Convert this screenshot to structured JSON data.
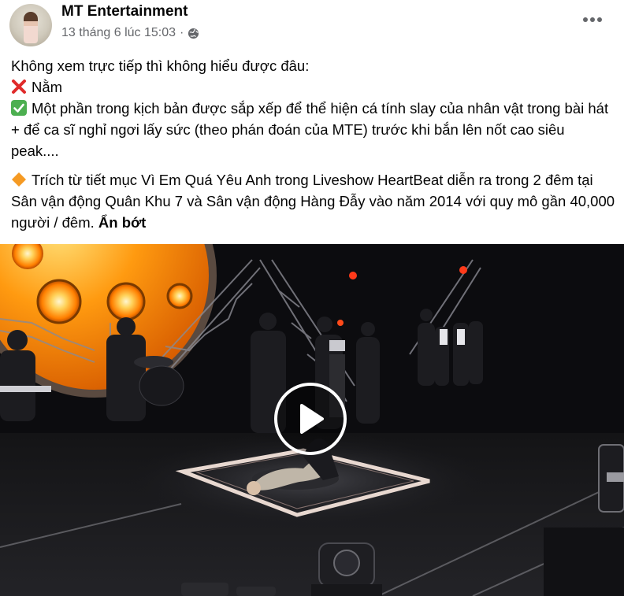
{
  "post": {
    "author": "MT Entertainment",
    "timestamp": "13 tháng 6 lúc 15:03",
    "separator": "·",
    "audience_icon": "globe-icon",
    "more_icon": "more-dots-icon"
  },
  "content": {
    "intro": "Không xem trực tiếp thì không hiểu được đâu:",
    "line_no": "Nằm",
    "line_no_icon": "cross-mark-icon",
    "line_yes": "Một phần trong kịch bản được sắp xếp để thể hiện cá tính slay của nhân vật trong bài hát + để ca sĩ nghỉ ngơi lấy sức (theo phán đoán của MTE) trước khi bắn lên nốt cao siêu peak....",
    "line_yes_icon": "check-mark-icon",
    "detail": "Trích từ tiết mục Vì Em Quá Yêu Anh trong Liveshow HeartBeat diễn ra trong 2 đêm tại Sân vận động Quân Khu 7 và Sân vận động Hàng Đẫy vào năm 2014 với quy mô gần 40,000 người / đêm.",
    "detail_icon": "orange-diamond-icon",
    "see_less": "Ẩn bớt"
  },
  "video": {
    "play_icon": "play-icon",
    "colors": {
      "stage_light": "#ff8a00",
      "stage_floor": "#1e1e22",
      "square_outline": "#e8d8d0"
    }
  }
}
